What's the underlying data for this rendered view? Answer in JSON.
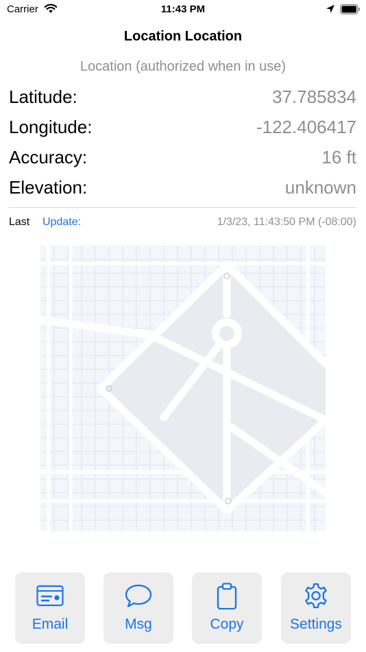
{
  "status_bar": {
    "carrier": "Carrier",
    "time": "11:43 PM"
  },
  "header": {
    "title": "Location Location",
    "subtitle": "Location (authorized when in use)"
  },
  "readings": [
    {
      "label": "Latitude:",
      "value": "37.785834"
    },
    {
      "label": "Longitude:",
      "value": "-122.406417"
    },
    {
      "label": "Accuracy:",
      "value": "16 ft"
    },
    {
      "label": "Elevation:",
      "value": "unknown"
    }
  ],
  "last_update": {
    "label": "Last",
    "link": "Update:",
    "timestamp": "1/3/23, 11:43:50 PM (-08:00)"
  },
  "toolbar": {
    "email": "Email",
    "msg": "Msg",
    "copy": "Copy",
    "settings": "Settings"
  },
  "colors": {
    "accent": "#1a73e8",
    "secondary_text": "#8e8e93",
    "button_bg": "#ededed"
  }
}
